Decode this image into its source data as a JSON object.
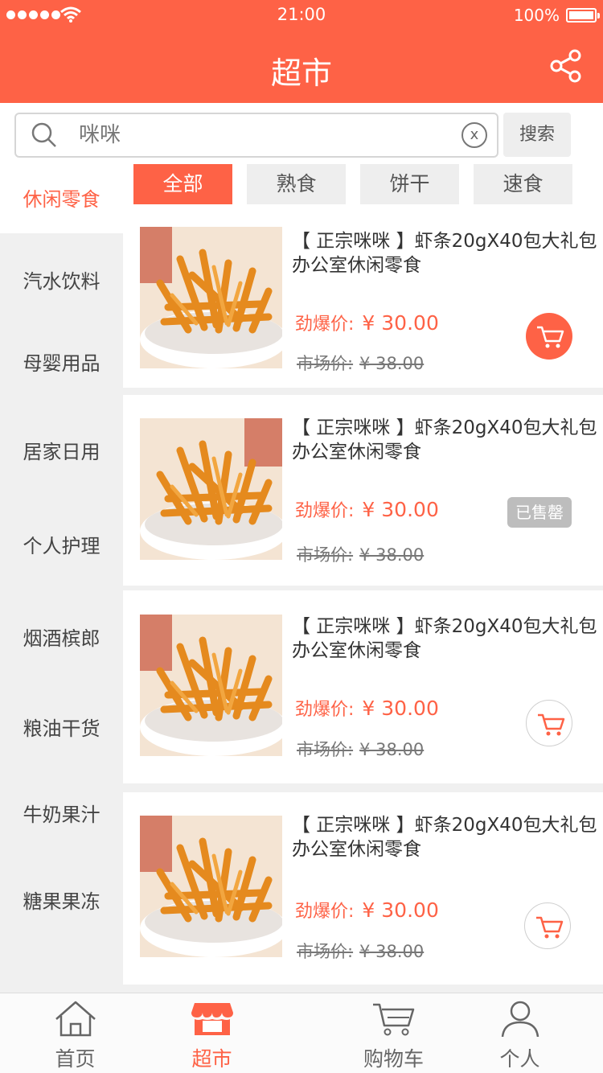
{
  "status": {
    "time": "21:00",
    "battery": "100%"
  },
  "header": {
    "title": "超市",
    "share_icon": "share-icon"
  },
  "search": {
    "placeholder": "咪咪",
    "button_label": "搜索",
    "clear_icon_text": "x"
  },
  "sidebar": {
    "items": [
      {
        "label": "休闲零食",
        "active": true
      },
      {
        "label": "汽水饮料",
        "active": false
      },
      {
        "label": "母婴用品",
        "active": false
      },
      {
        "label": "居家日用",
        "active": false
      },
      {
        "label": "个人护理",
        "active": false
      },
      {
        "label": "烟酒槟郎",
        "active": false
      },
      {
        "label": "粮油干货",
        "active": false
      },
      {
        "label": "牛奶果汁",
        "active": false
      },
      {
        "label": "糖果果冻",
        "active": false
      }
    ]
  },
  "filters": [
    {
      "label": "全部",
      "active": true
    },
    {
      "label": "熟食",
      "active": false
    },
    {
      "label": "饼干",
      "active": false
    },
    {
      "label": "速食",
      "active": false
    }
  ],
  "products": [
    {
      "title": "【 正宗咪咪 】虾条20gX40包大礼包办公室休闲零食",
      "price_label": "劲爆价:",
      "price": "¥ 30.00",
      "market_label": "市场价:",
      "market_price": "¥ 38.00",
      "action": "cart-solid"
    },
    {
      "title": "【 正宗咪咪 】虾条20gX40包大礼包办公室休闲零食",
      "price_label": "劲爆价:",
      "price": "¥ 30.00",
      "market_label": "市场价:",
      "market_price": "¥ 38.00",
      "action": "soldout",
      "soldout_label": "已售罄"
    },
    {
      "title": "【 正宗咪咪 】虾条20gX40包大礼包办公室休闲零食",
      "price_label": "劲爆价:",
      "price": "¥ 30.00",
      "market_label": "市场价:",
      "market_price": "¥ 38.00",
      "action": "cart-outline"
    },
    {
      "title": "【 正宗咪咪 】虾条20gX40包大礼包办公室休闲零食",
      "price_label": "劲爆价:",
      "price": "¥ 30.00",
      "market_label": "市场价:",
      "market_price": "¥ 38.00",
      "action": "cart-outline"
    }
  ],
  "tabbar": [
    {
      "label": "首页",
      "icon": "home-icon",
      "active": false
    },
    {
      "label": "超市",
      "icon": "store-icon",
      "active": true
    },
    {
      "label": "购物车",
      "icon": "cart-icon",
      "active": false
    },
    {
      "label": "个人",
      "icon": "person-icon",
      "active": false
    }
  ],
  "colors": {
    "accent": "#fe6246",
    "sidebar_bg": "#f0f0f0",
    "tab_bg": "#eeeeee"
  }
}
